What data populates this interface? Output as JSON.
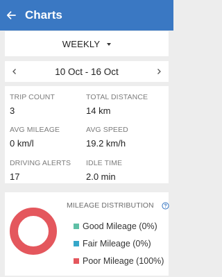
{
  "header": {
    "title": "Charts"
  },
  "period": {
    "selected": "WEEKLY"
  },
  "range": {
    "label": "10 Oct - 16 Oct"
  },
  "stats": [
    {
      "label": "TRIP COUNT",
      "value": "3"
    },
    {
      "label": "TOTAL DISTANCE",
      "value": "14 km"
    },
    {
      "label": "AVG MILEAGE",
      "value": "0 km/l"
    },
    {
      "label": "AVG SPEED",
      "value": "19.2 km/h"
    },
    {
      "label": "DRIVING ALERTS",
      "value": "17"
    },
    {
      "label": "IDLE TIME",
      "value": "2.0 min"
    }
  ],
  "distribution": {
    "title": "MILEAGE DISTRIBUTION",
    "legend": [
      {
        "label": "Good Mileage (0%)",
        "color": "#5fbfa6"
      },
      {
        "label": "Fair Mileage (0%)",
        "color": "#35a7c9"
      },
      {
        "label": "Poor Mileage (100%)",
        "color": "#e4575d"
      }
    ]
  },
  "chart_data": {
    "type": "pie",
    "categories": [
      "Good Mileage",
      "Fair Mileage",
      "Poor Mileage"
    ],
    "values": [
      0,
      0,
      100
    ],
    "colors": [
      "#5fbfa6",
      "#35a7c9",
      "#e4575d"
    ]
  },
  "icons": {
    "back": "arrow-left-icon",
    "dropdown": "caret-down-icon",
    "prev": "chevron-left-icon",
    "next": "chevron-right-icon",
    "help": "help-circle-icon"
  },
  "colors": {
    "appbar": "#3a78c3",
    "accent": "#3a78c3"
  }
}
